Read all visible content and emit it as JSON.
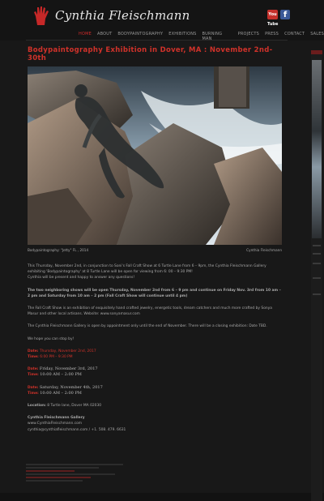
{
  "brand": {
    "name": "Cynthia Fleischmann"
  },
  "social": {
    "youtube_label": "You Tube",
    "facebook_label": "f"
  },
  "nav": {
    "items": [
      "HOME",
      "ABOUT",
      "BODYPAINTOGRAPHY",
      "EXHIBITIONS",
      "BURNING MAN",
      "PROJECTS",
      "PRESS",
      "CONTACT",
      "SALES"
    ],
    "active": "HOME"
  },
  "post": {
    "title": "Bodypaintography Exhibition in Dover, MA : November 2nd-30th",
    "caption_left": "Bodypaintography: \"Jetty\" FL , 2014",
    "caption_right": "Cynthia Fleischmann",
    "p1": "This Thursday, November 2nd, in conjunction to Soni's Fall Craft Show at 6 Turtle Lane from 6 – 9pm, the Cynthia Fleischmann Gallery exhibiting 'Bodypaintography' at 8 Turtle Lane will be open for viewing from 6: 00 – 9:30 PM!",
    "p1b": "Cynthia will be present and happy to answer any questions!",
    "p2": "The two neighboring shows will be open Thursday, November 2nd from 6 – 9 pm and continue on Friday Nov. 3rd from 10 am – 2 pm and Saturday from 10 am – 2 pm (Fall Craft Show will continue until 4 pm)",
    "p3": "The Fall Craft Show is an exhibition of exquisitely hand crafted jewelry, energetic tools, dream catchers and much more crafted by Sonya Masur and other local artisans. Website: www.sonyamasur.com",
    "p4": "The Cynthia Fleischmann Gallery is open by appointment only until the end of November. There will be a closing exhibition: Date TBD.",
    "p5": "We hope you can stop by!",
    "date_label": "Date:",
    "time_label": "Time:",
    "date1": "Thursday, November 2nd, 2017",
    "time1": "6:00 PM – 9:30 PM",
    "date2": "Friday, November 3rd, 2017",
    "time2": "10:00 AM – 2:00 PM",
    "date3": "Saturday, November 4th, 2017",
    "time3": "10:00 AM – 2:00 PM",
    "location_label": "Location:",
    "location": "8 Turtle lane, Dover MA 02030",
    "gallery_name": "Cynthia Fleischmann Gallery",
    "gallery_web": "www.CynthiaFleischmann.com",
    "gallery_contact": "cynthia@cynthiafleischmann.com / +1. 508. 479. 6631"
  },
  "colors": {
    "accent": "#d0322a",
    "background": "#181818",
    "text": "#a8a8a8"
  }
}
